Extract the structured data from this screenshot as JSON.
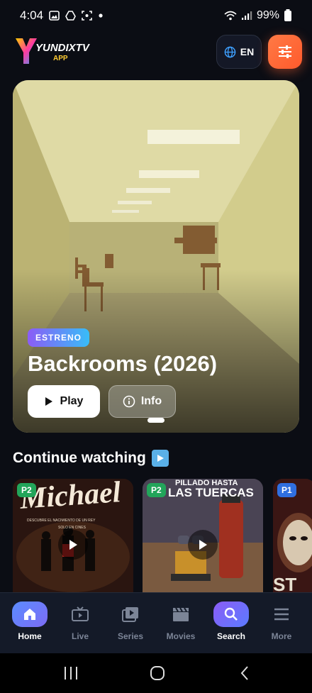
{
  "status_bar": {
    "time": "4:04",
    "battery": "99%"
  },
  "header": {
    "logo_text": "YUNDIXTV",
    "logo_sub": "APP",
    "lang_label": "EN"
  },
  "hero": {
    "badge": "ESTRENO",
    "title": "Backrooms (2026)",
    "play_label": "Play",
    "info_label": "Info"
  },
  "continue_watching": {
    "title": "Continue watching",
    "items": [
      {
        "badge": "P2",
        "title_art": "Michael",
        "tagline": "DESCUBRE EL NACIMIENTO DE UN REY",
        "sub": "SOLO EN CINES"
      },
      {
        "badge": "P2",
        "title_art": "PILLADO HASTA",
        "title_art_2": "LAS TUERCAS"
      },
      {
        "badge": "P1",
        "title_art": "ST"
      }
    ]
  },
  "bottom_nav": {
    "items": [
      {
        "label": "Home",
        "icon": "home-icon"
      },
      {
        "label": "Live",
        "icon": "tv-icon"
      },
      {
        "label": "Series",
        "icon": "series-icon"
      },
      {
        "label": "Movies",
        "icon": "clapperboard-icon"
      },
      {
        "label": "Search",
        "icon": "search-icon"
      },
      {
        "label": "More",
        "icon": "menu-icon"
      }
    ]
  },
  "colors": {
    "accent_orange": "#ff6a38",
    "accent_purple": "#8b5cf6",
    "background": "#0b0d14"
  }
}
